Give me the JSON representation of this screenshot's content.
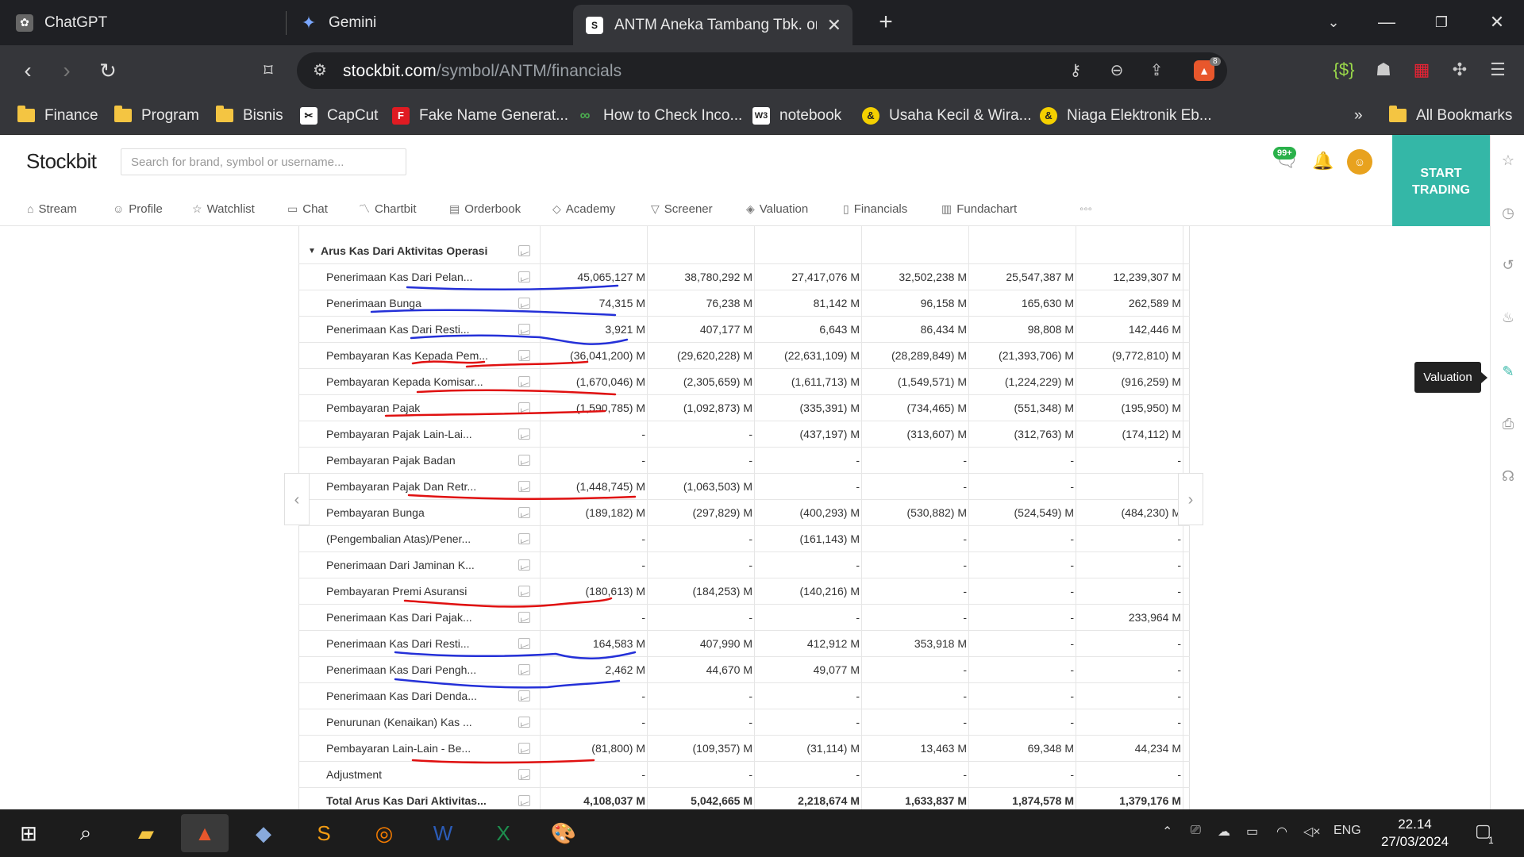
{
  "browser": {
    "tabs": [
      {
        "label": "ChatGPT"
      },
      {
        "label": "Gemini"
      },
      {
        "label": "ANTM Aneka Tambang Tbk. on S"
      }
    ],
    "url": {
      "host": "stockbit.com",
      "path": "/symbol/ANTM/financials"
    },
    "ext_badge": "8",
    "bookmarks": [
      {
        "label": "Finance",
        "icon": "folder-icon"
      },
      {
        "label": "Program",
        "icon": "folder-icon"
      },
      {
        "label": "Bisnis",
        "icon": "folder-icon"
      },
      {
        "label": "CapCut",
        "icon": "capcut-icon"
      },
      {
        "label": "Fake Name Generat...",
        "icon": "f-icon"
      },
      {
        "label": "How to Check Inco...",
        "icon": "infinity-icon"
      },
      {
        "label": "notebook",
        "icon": "w3-icon"
      },
      {
        "label": "Usaha Kecil & Wira...",
        "icon": "ampersand-icon"
      },
      {
        "label": "Niaga Elektronik Eb...",
        "icon": "ampersand-icon"
      }
    ],
    "all_bookmarks": "All Bookmarks",
    "more": "»"
  },
  "stockbit": {
    "logo": "Stockbit",
    "search_placeholder": "Search for brand, symbol or username...",
    "msg_badge": "99+",
    "start_trading_1": "START",
    "start_trading_2": "TRADING",
    "menu": [
      "Stream",
      "Profile",
      "Watchlist",
      "Chat",
      "Chartbit",
      "Orderbook",
      "Academy",
      "Screener",
      "Valuation",
      "Financials",
      "Fundachart"
    ],
    "menu_more": "◦◦◦",
    "tooltip": "Valuation"
  },
  "table": {
    "section": "Arus Kas Dari Aktivitas Operasi",
    "rows": [
      {
        "label": "Penerimaan Kas Dari Pelan...",
        "v": [
          "45,065,127 M",
          "38,780,292 M",
          "27,417,076 M",
          "32,502,238 M",
          "25,547,387 M",
          "12,239,307 M"
        ]
      },
      {
        "label": "Penerimaan Bunga",
        "v": [
          "74,315 M",
          "76,238 M",
          "81,142 M",
          "96,158 M",
          "165,630 M",
          "262,589 M"
        ]
      },
      {
        "label": "Penerimaan Kas Dari Resti...",
        "v": [
          "3,921 M",
          "407,177 M",
          "6,643 M",
          "86,434 M",
          "98,808 M",
          "142,446 M"
        ]
      },
      {
        "label": "Pembayaran Kas Kepada Pem...",
        "v": [
          "(36,041,200) M",
          "(29,620,228) M",
          "(22,631,109) M",
          "(28,289,849) M",
          "(21,393,706) M",
          "(9,772,810) M"
        ]
      },
      {
        "label": "Pembayaran Kepada Komisar...",
        "v": [
          "(1,670,046) M",
          "(2,305,659) M",
          "(1,611,713) M",
          "(1,549,571) M",
          "(1,224,229) M",
          "(916,259) M"
        ]
      },
      {
        "label": "Pembayaran Pajak",
        "v": [
          "(1,590,785) M",
          "(1,092,873) M",
          "(335,391) M",
          "(734,465) M",
          "(551,348) M",
          "(195,950) M"
        ]
      },
      {
        "label": "Pembayaran Pajak Lain-Lai...",
        "v": [
          "-",
          "-",
          "(437,197) M",
          "(313,607) M",
          "(312,763) M",
          "(174,112) M"
        ]
      },
      {
        "label": "Pembayaran Pajak Badan",
        "v": [
          "-",
          "-",
          "-",
          "-",
          "-",
          "-"
        ]
      },
      {
        "label": "Pembayaran Pajak Dan Retr...",
        "v": [
          "(1,448,745) M",
          "(1,063,503) M",
          "-",
          "-",
          "-",
          "-"
        ]
      },
      {
        "label": "Pembayaran Bunga",
        "v": [
          "(189,182) M",
          "(297,829) M",
          "(400,293) M",
          "(530,882) M",
          "(524,549) M",
          "(484,230) M"
        ]
      },
      {
        "label": "(Pengembalian Atas)/Pener...",
        "v": [
          "-",
          "-",
          "(161,143) M",
          "-",
          "-",
          "-"
        ]
      },
      {
        "label": "Penerimaan Dari Jaminan K...",
        "v": [
          "-",
          "-",
          "-",
          "-",
          "-",
          "-"
        ]
      },
      {
        "label": "Pembayaran Premi Asuransi",
        "v": [
          "(180,613) M",
          "(184,253) M",
          "(140,216) M",
          "-",
          "-",
          "-"
        ]
      },
      {
        "label": "Penerimaan Kas Dari Pajak...",
        "v": [
          "-",
          "-",
          "-",
          "-",
          "-",
          "233,964 M"
        ]
      },
      {
        "label": "Penerimaan Kas Dari Resti...",
        "v": [
          "164,583 M",
          "407,990 M",
          "412,912 M",
          "353,918 M",
          "-",
          "-"
        ]
      },
      {
        "label": "Penerimaan Kas Dari Pengh...",
        "v": [
          "2,462 M",
          "44,670 M",
          "49,077 M",
          "-",
          "-",
          "-"
        ]
      },
      {
        "label": "Penerimaan Kas Dari Denda...",
        "v": [
          "-",
          "-",
          "-",
          "-",
          "-",
          "-"
        ]
      },
      {
        "label": "Penurunan (Kenaikan) Kas ...",
        "v": [
          "-",
          "-",
          "-",
          "-",
          "-",
          "-"
        ]
      },
      {
        "label": "Pembayaran Lain-Lain - Be...",
        "v": [
          "(81,800) M",
          "(109,357) M",
          "(31,114) M",
          "13,463 M",
          "69,348 M",
          "44,234 M"
        ]
      },
      {
        "label": "Adjustment",
        "v": [
          "-",
          "-",
          "-",
          "-",
          "-",
          "-"
        ]
      },
      {
        "label": "Total Arus Kas Dari Aktivitas...",
        "v": [
          "4,108,037 M",
          "5,042,665 M",
          "2,218,674 M",
          "1,633,837 M",
          "1,874,578 M",
          "1,379,176 M"
        ]
      }
    ]
  },
  "taskbar": {
    "lang": "ENG",
    "time": "22.14",
    "date": "27/03/2024",
    "notif": "1"
  },
  "colors": {
    "accent": "#34b7a7",
    "blue_annotation": "#2430d8",
    "red_annotation": "#e01010"
  }
}
